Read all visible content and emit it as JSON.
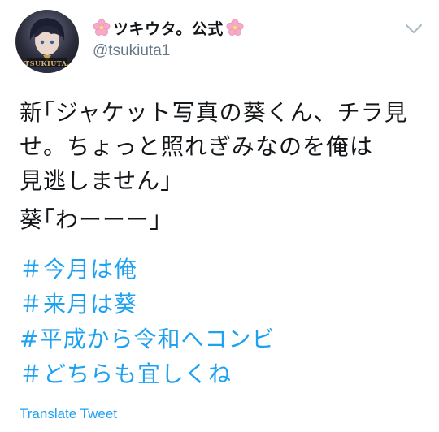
{
  "account": {
    "display_name": "ツキウタ。公式",
    "handle": "@tsukiuta1",
    "avatar_logo_text": "TSUKIUTA."
  },
  "tweet": {
    "lines": [
      "新｢ジャケット写真の葵くん、チラ見",
      "せ。ちょっと照れぎみなのを俺は",
      "見逃しません｣",
      "葵｢わーーー｣"
    ],
    "hashtags": [
      "＃今月は俺",
      "＃来月は葵",
      "#平成から令和へコンビ",
      "＃どちらも宜しくね"
    ]
  },
  "actions": {
    "translate_label": "Translate Tweet"
  },
  "icons": {
    "menu": "chevron-down-icon",
    "emoji": "cherry-blossom-icon"
  },
  "colors": {
    "link": "#1da1f2",
    "secondary": "#657786",
    "text": "#14171a",
    "blossom": "#f6a9c9"
  }
}
